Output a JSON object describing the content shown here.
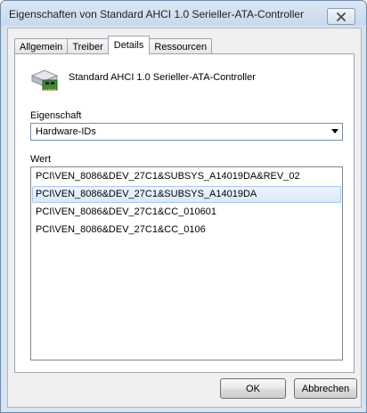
{
  "window": {
    "title": "Eigenschaften von Standard AHCI 1.0 Serieller-ATA-Controller"
  },
  "tabs": [
    {
      "label": "Allgemein"
    },
    {
      "label": "Treiber"
    },
    {
      "label": "Details"
    },
    {
      "label": "Ressourcen"
    }
  ],
  "details": {
    "device_icon": "disk-controller-icon",
    "device_name": "Standard AHCI 1.0 Serieller-ATA-Controller",
    "property_label": "Eigenschaft",
    "property_selected": "Hardware-IDs",
    "value_label": "Wert",
    "values": [
      "PCI\\VEN_8086&DEV_27C1&SUBSYS_A14019DA&REV_02",
      "PCI\\VEN_8086&DEV_27C1&SUBSYS_A14019DA",
      "PCI\\VEN_8086&DEV_27C1&CC_010601",
      "PCI\\VEN_8086&DEV_27C1&CC_0106"
    ]
  },
  "buttons": {
    "ok": "OK",
    "cancel": "Abbrechen"
  }
}
